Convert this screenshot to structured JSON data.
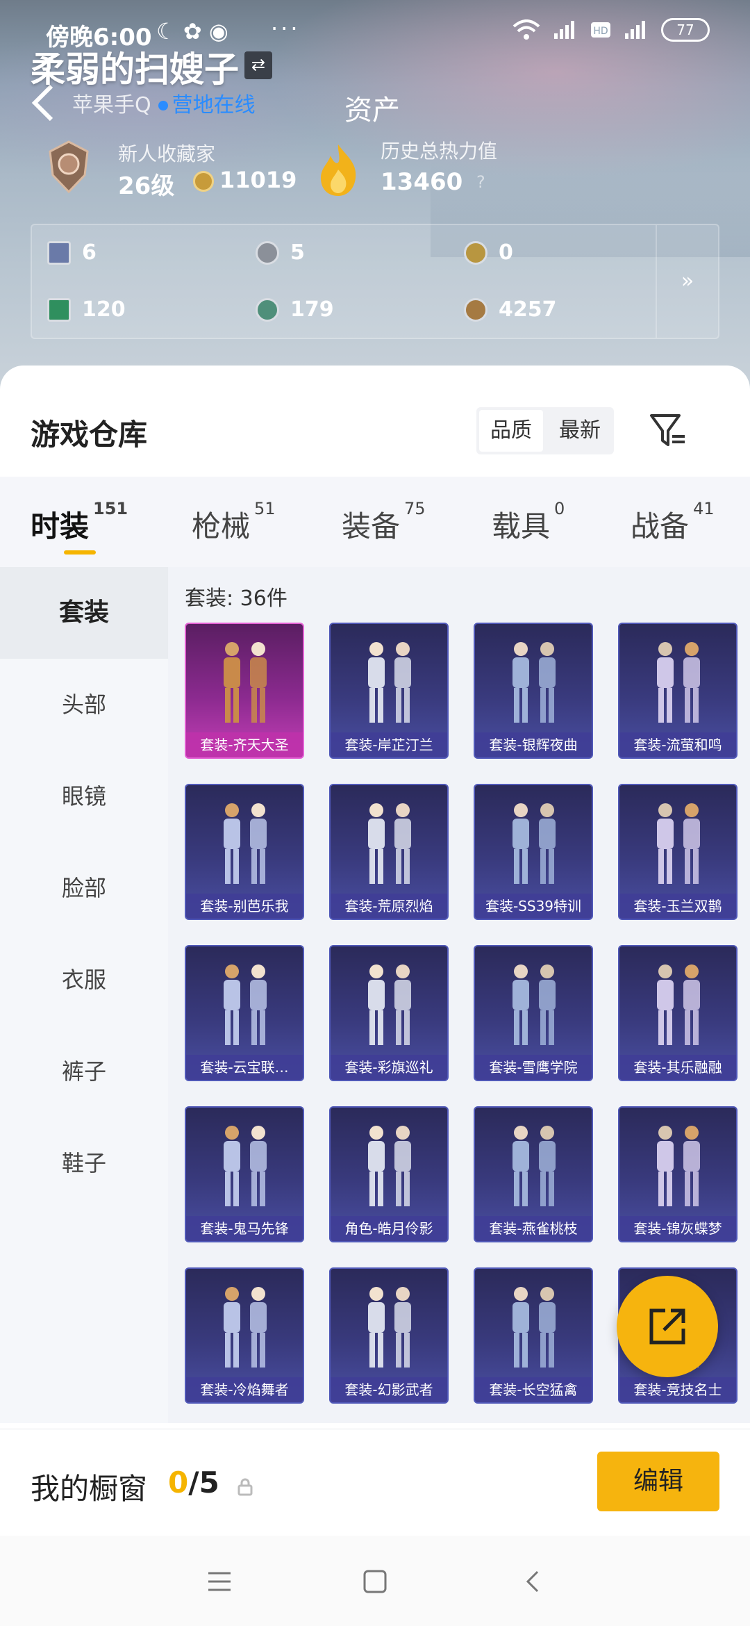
{
  "status_bar": {
    "time": "傍晚6:00",
    "left_icons": "☾ ✿ ◉",
    "dots": "···",
    "network": "4G 4G",
    "battery": "77"
  },
  "header": {
    "username": "柔弱的扫嫂子",
    "swap_glyph": "⇄",
    "subtitle_prefix": "苹果手Q",
    "online_status": "营地在线",
    "page_title": "资产"
  },
  "profile": {
    "rank_title": "新人收藏家",
    "level": "26级",
    "coins": "11019",
    "heat_title": "历史总热力值",
    "heat_value": "13460",
    "help": "?"
  },
  "stats": [
    {
      "value": "6",
      "color": "#6a7aa8"
    },
    {
      "value": "5",
      "color": "#8b9099"
    },
    {
      "value": "0",
      "color": "#b89640"
    },
    {
      "value": "120",
      "color": "#2f8f5e"
    },
    {
      "value": "179",
      "color": "#4f8f7a"
    },
    {
      "value": "4257",
      "color": "#a57a42"
    }
  ],
  "stats_more": "»",
  "warehouse": {
    "title": "游戏仓库",
    "sort_options": [
      "品质",
      "最新"
    ],
    "active_sort": "品质"
  },
  "tabs": [
    {
      "label": "时装",
      "count": "151"
    },
    {
      "label": "枪械",
      "count": "51"
    },
    {
      "label": "装备",
      "count": "75"
    },
    {
      "label": "载具",
      "count": "0"
    },
    {
      "label": "战备",
      "count": "41"
    }
  ],
  "sidebar": [
    "套装",
    "头部",
    "眼镜",
    "脸部",
    "衣服",
    "裤子",
    "鞋子"
  ],
  "grid": {
    "count_label": "套装: 36件",
    "items": [
      {
        "label": "套装-齐天大圣",
        "rarity": "gold"
      },
      {
        "label": "套装-岸芷汀兰",
        "rarity": "purple"
      },
      {
        "label": "套装-银辉夜曲",
        "rarity": "purple"
      },
      {
        "label": "套装-流萤和鸣",
        "rarity": "purple"
      },
      {
        "label": "套装-别芭乐我",
        "rarity": "purple"
      },
      {
        "label": "套装-荒原烈焰",
        "rarity": "purple"
      },
      {
        "label": "套装-SS39特训",
        "rarity": "purple"
      },
      {
        "label": "套装-玉兰双鹊",
        "rarity": "purple"
      },
      {
        "label": "套装-云宝联…",
        "rarity": "purple"
      },
      {
        "label": "套装-彩旗巡礼",
        "rarity": "purple"
      },
      {
        "label": "套装-雪鹰学院",
        "rarity": "purple"
      },
      {
        "label": "套装-其乐融融",
        "rarity": "purple"
      },
      {
        "label": "套装-鬼马先锋",
        "rarity": "purple"
      },
      {
        "label": "角色-皓月伶影",
        "rarity": "purple"
      },
      {
        "label": "套装-燕雀桃枝",
        "rarity": "purple"
      },
      {
        "label": "套装-锦灰蝶梦",
        "rarity": "purple"
      },
      {
        "label": "套装-冷焰舞者",
        "rarity": "purple"
      },
      {
        "label": "套装-幻影武者",
        "rarity": "purple"
      },
      {
        "label": "套装-长空猛禽",
        "rarity": "purple"
      },
      {
        "label": "套装-竞技名士",
        "rarity": "purple"
      }
    ]
  },
  "showcase": {
    "label": "我的橱窗",
    "current": "0",
    "total": "/5",
    "edit_label": "编辑"
  },
  "colors": {
    "accent": "#f6b40e",
    "online": "#2a8cff",
    "card_purple": "#393a7d",
    "card_gold": "#8b2a8f"
  }
}
